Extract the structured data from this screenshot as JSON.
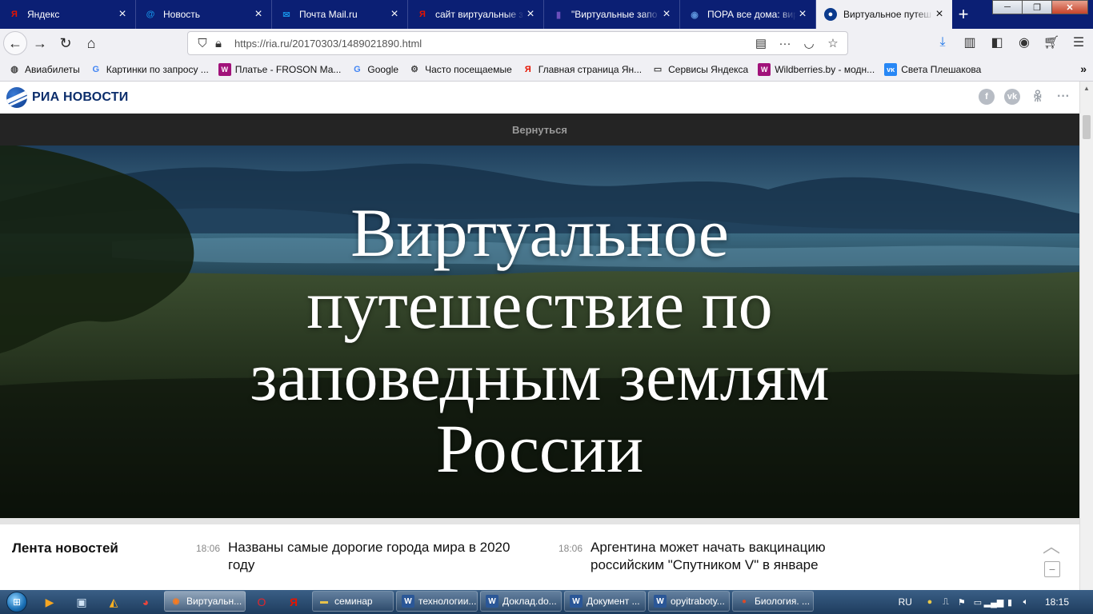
{
  "browser": {
    "tabs": [
      {
        "title": "Яндекс",
        "favicon": "yandex-icon",
        "favicon_char": "Я",
        "favicon_color": "#e61400",
        "active": false
      },
      {
        "title": "Новость",
        "favicon": "mailru-at-icon",
        "favicon_char": "@",
        "favicon_color": "#168de2",
        "active": false
      },
      {
        "title": "Почта Mail.ru",
        "favicon": "mail-envelope-icon",
        "favicon_char": "✉",
        "favicon_color": "#168de2",
        "active": false
      },
      {
        "title": "сайт виртуальные з",
        "favicon": "yandex-icon",
        "favicon_char": "Я",
        "favicon_color": "#e61400",
        "active": false
      },
      {
        "title": "\"Виртуальные запо",
        "favicon": "document-icon",
        "favicon_char": "▮",
        "favicon_color": "#6b4fbb",
        "active": false
      },
      {
        "title": "ПОРА все дома: вир",
        "favicon": "globe-icon",
        "favicon_char": "◉",
        "favicon_color": "#5a8fd8",
        "active": false
      },
      {
        "title": "Виртуальное путеш",
        "favicon": "ria-icon",
        "favicon_char": "●",
        "favicon_color": "#0b3a8c",
        "active": true
      }
    ],
    "new_tab_label": "+",
    "window_controls": {
      "minimize": "─",
      "maximize": "❐",
      "close": "✕"
    },
    "url": "https://ria.ru/20170303/1489021890.html",
    "bookmarks": [
      {
        "label": "Авиабилеты",
        "icon": "globe-icon",
        "char": "◍",
        "color": "#444"
      },
      {
        "label": "Картинки по запросу ...",
        "icon": "google-icon",
        "char": "G",
        "color": "#4285f4"
      },
      {
        "label": "Платье - FROSON Ма...",
        "icon": "wildberries-icon",
        "char": "W",
        "color": "#a1127a"
      },
      {
        "label": "Google",
        "icon": "google-icon",
        "char": "G",
        "color": "#4285f4"
      },
      {
        "label": "Часто посещаемые",
        "icon": "gear-icon",
        "char": "⚙",
        "color": "#444"
      },
      {
        "label": "Главная страница Ян...",
        "icon": "yandex-icon",
        "char": "Я",
        "color": "#e61400"
      },
      {
        "label": "Сервисы Яндекса",
        "icon": "folder-icon",
        "char": "▭",
        "color": "#444"
      },
      {
        "label": "Wildberries.by - модн...",
        "icon": "wildberries-icon",
        "char": "W",
        "color": "#a1127a"
      },
      {
        "label": "Света Плешакова",
        "icon": "vk-icon",
        "char": "ᴠᴋ",
        "color": "#2787f5"
      }
    ]
  },
  "site": {
    "logo_text": "РИА НОВОСТИ",
    "back_link": "Вернуться",
    "hero_title_lines": [
      "Виртуальное",
      "путешествие по",
      "заповедным землям",
      "России"
    ],
    "news_heading": "Лента новостей",
    "news": [
      {
        "time": "18:06",
        "text": "Названы самые дорогие города мира в 2020 году"
      },
      {
        "time": "18:06",
        "text": "Аргентина может начать вакцинацию российским \"Спутником V\" в январе"
      }
    ]
  },
  "taskbar": {
    "tasks": [
      {
        "label": "Виртуальн...",
        "icon": "firefox-icon",
        "char": "◉",
        "color": "#ff7a1a",
        "active": true
      },
      {
        "label": "семинар",
        "icon": "folder-icon",
        "char": "▬",
        "color": "#e8c24a",
        "active": false
      },
      {
        "label": "технологии...",
        "icon": "word-icon",
        "char": "W",
        "color": "#2b5797",
        "active": false
      },
      {
        "label": "Доклад.do...",
        "icon": "word-icon",
        "char": "W",
        "color": "#2b5797",
        "active": false
      },
      {
        "label": "Документ ...",
        "icon": "word-icon",
        "char": "W",
        "color": "#2b5797",
        "active": false
      },
      {
        "label": "opyitraboty...",
        "icon": "word-icon",
        "char": "W",
        "color": "#2b5797",
        "active": false
      },
      {
        "label": "Биология. ...",
        "icon": "apple-icon",
        "char": "●",
        "color": "#d94a2a",
        "active": false
      }
    ],
    "language": "RU",
    "time": "18:15"
  }
}
